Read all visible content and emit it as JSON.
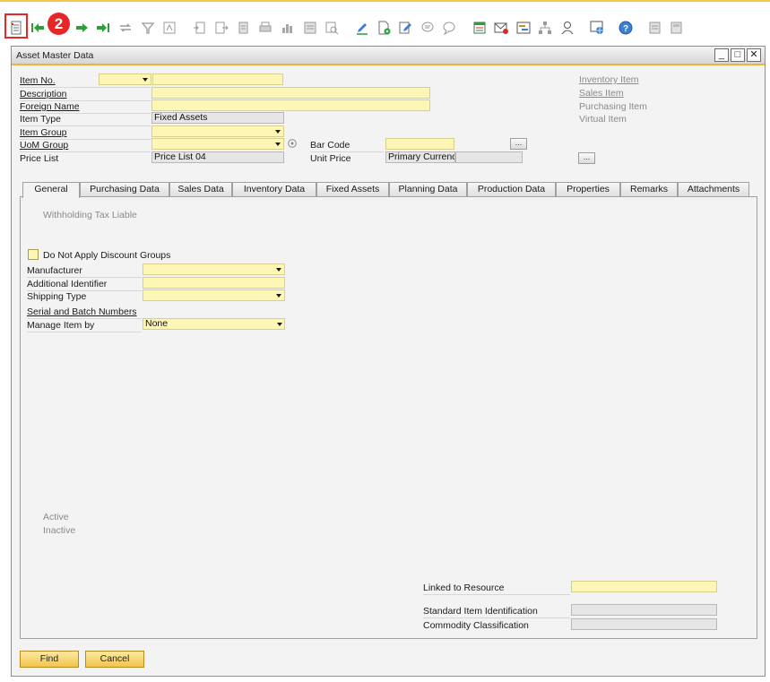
{
  "toolbar": {
    "step_number": "2",
    "icons": [
      "form-settings-icon",
      "first-record-icon",
      "previous-record-icon",
      "next-record-icon",
      "last-record-icon",
      "refresh-icon",
      "filter-icon",
      "sort-icon",
      "copy-from-icon",
      "copy-to-icon",
      "print-preview-icon",
      "print-icon",
      "chart-icon",
      "export-icon",
      "lookup-icon",
      "edit-icon",
      "new-document-icon",
      "add-document-icon",
      "message-icon",
      "comment-icon",
      "settings-grid-icon",
      "email-icon",
      "gantt-icon",
      "hierarchy-icon",
      "user-icon",
      "web-browser-icon",
      "help-icon",
      "report-icon",
      "layout-icon"
    ]
  },
  "window": {
    "title": "Asset Master Data",
    "minimize": "_",
    "maximize": "□",
    "close": "✕"
  },
  "header": {
    "item_no_label": "Item No.",
    "description_label": "Description",
    "foreign_name_label": "Foreign Name",
    "item_type_label": "Item Type",
    "item_type_value": "Fixed Assets",
    "item_group_label": "Item Group",
    "uom_group_label": "UoM Group",
    "price_list_label": "Price List",
    "price_list_value": "Price List 04",
    "bar_code_label": "Bar Code",
    "unit_price_label": "Unit Price",
    "unit_price_currency": "Primary Currency",
    "browse_label": "...",
    "item_kinds": [
      "Inventory Item",
      "Sales Item",
      "Purchasing Item",
      "Virtual Item"
    ]
  },
  "tabs": [
    "General",
    "Purchasing Data",
    "Sales Data",
    "Inventory Data",
    "Fixed Assets",
    "Planning Data",
    "Production Data",
    "Properties",
    "Remarks",
    "Attachments"
  ],
  "general": {
    "withholding_tax": "Withholding Tax Liable",
    "do_not_apply_discount": "Do Not Apply Discount Groups",
    "manufacturer_label": "Manufacturer",
    "additional_identifier_label": "Additional Identifier",
    "shipping_type_label": "Shipping Type",
    "serial_batch_link": "Serial and Batch Numbers",
    "manage_item_by_label": "Manage Item by",
    "manage_item_by_value": "None",
    "active_label": "Active",
    "inactive_label": "Inactive",
    "linked_to_resource_label": "Linked to Resource",
    "standard_item_id_label": "Standard Item Identification",
    "commodity_classification_label": "Commodity Classification"
  },
  "buttons": {
    "find": "Find",
    "cancel": "Cancel"
  },
  "colors": {
    "accent": "#f0b43c",
    "field_yellow": "#fdf6b4",
    "highlight_red": "#e52727"
  }
}
